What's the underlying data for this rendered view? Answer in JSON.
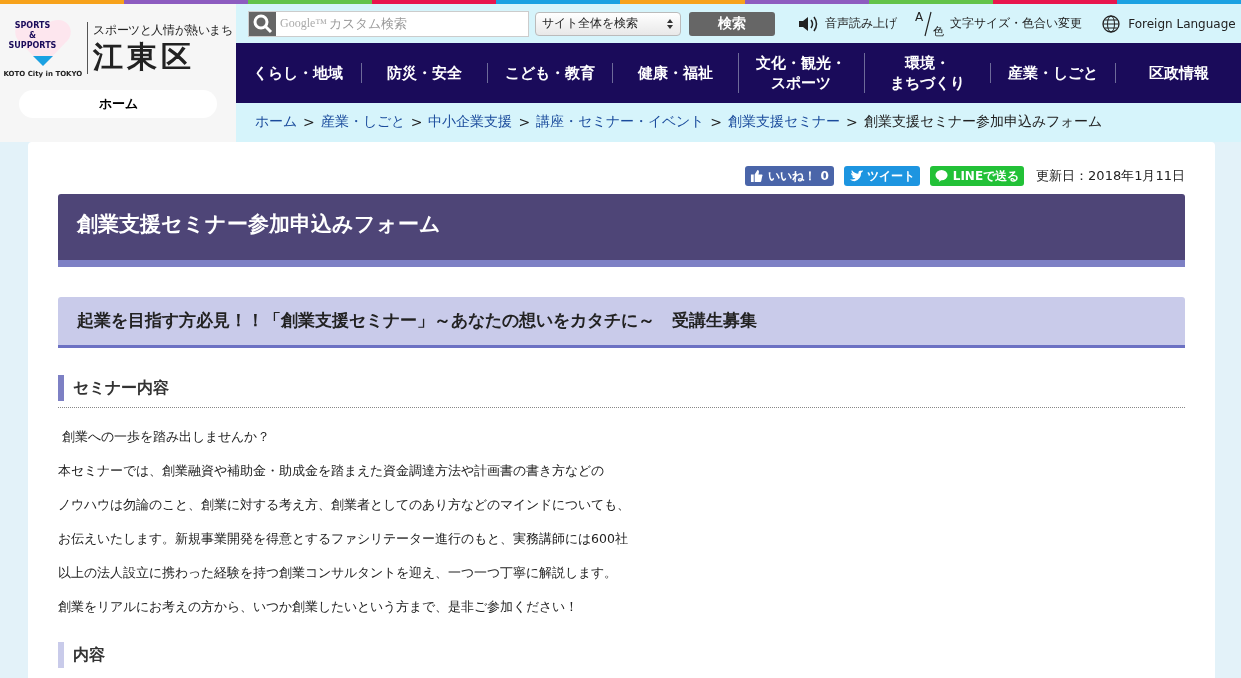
{
  "logo": {
    "heart_top": "SPORTS",
    "heart_mid": "&",
    "heart_bottom": "SUPPORTS",
    "city_line": "KOTO City in TOKYO",
    "tagline": "スポーツと人情が熱いまち",
    "name": "江東区"
  },
  "home_button": "ホーム",
  "search": {
    "placeholder": "カスタム検索",
    "brand": "Google™",
    "scope": "サイト全体を検索",
    "button": "検索"
  },
  "tools": [
    {
      "kind": "speaker",
      "label": "音声読み上げ"
    },
    {
      "kind": "font",
      "icon_top": "A",
      "icon_bottom": "色",
      "label": "文字サイズ・色合い変更"
    },
    {
      "kind": "globe",
      "label": "Foreign Language"
    }
  ],
  "nav": [
    {
      "lines": [
        "くらし・地域"
      ]
    },
    {
      "lines": [
        "防災・安全"
      ]
    },
    {
      "lines": [
        "こども・教育"
      ]
    },
    {
      "lines": [
        "健康・福祉"
      ]
    },
    {
      "lines": [
        "文化・観光・",
        "スポーツ"
      ]
    },
    {
      "lines": [
        "環境・",
        "まちづくり"
      ]
    },
    {
      "lines": [
        "産業・しごと"
      ]
    },
    {
      "lines": [
        "区政情報"
      ]
    }
  ],
  "breadcrumb": [
    {
      "kind": "link",
      "label": "ホーム"
    },
    {
      "kind": "link",
      "separator": ">",
      "label": "産業・しごと"
    },
    {
      "kind": "link",
      "separator": ">",
      "label": "中小企業支援"
    },
    {
      "kind": "link",
      "separator": ">",
      "label": "講座・セミナー・イベント"
    },
    {
      "kind": "link",
      "separator": ">",
      "label": "創業支援セミナー"
    },
    {
      "kind": "current",
      "separator": ">",
      "label": "創業支援セミナー参加申込みフォーム"
    }
  ],
  "social": [
    {
      "kind": "like",
      "label": "いいね！",
      "count": "0"
    },
    {
      "kind": "tweet",
      "label": "ツイート"
    },
    {
      "kind": "line",
      "label": "LINEで送る"
    }
  ],
  "updated": "更新日：2018年1月11日",
  "page_title": "創業支援セミナー参加申込みフォーム",
  "subtitle": "起業を目指す方必見！！「創業支援セミナー」～あなたの想いをカタチに～　受講生募集",
  "sections": [
    {
      "heading": "セミナー内容",
      "paragraphs": [
        " 創業への一歩を踏み出しませんか？",
        "本セミナーでは、創業融資や補助金・助成金を踏まえた資金調達方法や計画書の書き方などの",
        "ノウハウは勿論のこと、創業に対する考え方、創業者としてのあり方などのマインドについても、",
        "お伝えいたします。新規事業開発を得意とするファシリテーター進行のもと、実務講師には600社",
        "以上の法人設立に携わった経験を持つ創業コンサルタントを迎え、一つ一つ丁寧に解説します。",
        "創業をリアルにお考えの方から、いつか創業したいという方まで、是非ご参加ください！"
      ]
    },
    {
      "heading": "内容"
    }
  ]
}
